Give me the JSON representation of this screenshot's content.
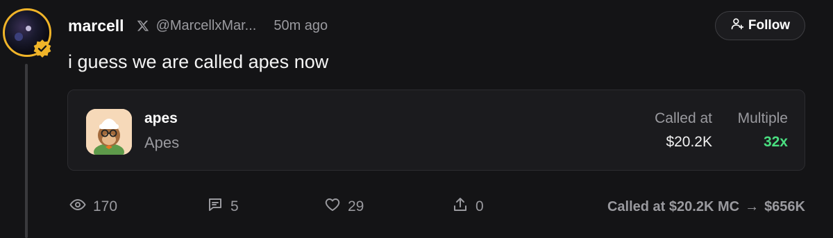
{
  "post": {
    "author_name": "marcell",
    "handle": "@MarcellxMar...",
    "time_ago": "50m ago",
    "text": "i guess we are called apes now",
    "follow_label": "Follow"
  },
  "token_card": {
    "symbol": "apes",
    "name": "Apes",
    "called_at_label": "Called at",
    "called_at_value": "$20.2K",
    "multiple_label": "Multiple",
    "multiple_value": "32x"
  },
  "stats": {
    "views": "170",
    "comments": "5",
    "likes": "29",
    "shares": "0"
  },
  "summary": {
    "called_text": "Called at $20.2K MC",
    "arrow": "→",
    "current_value": "$656K"
  },
  "colors": {
    "background": "#141416",
    "avatar_ring": "#f0b429",
    "multiple_positive": "#4ade80",
    "muted_text": "#9a9a9f"
  },
  "icons": {
    "verified": "verified-badge-icon",
    "x": "x-logo-icon",
    "follow": "user-plus-icon",
    "views": "eye-icon",
    "comments": "comment-icon",
    "likes": "heart-icon",
    "shares": "share-icon"
  }
}
